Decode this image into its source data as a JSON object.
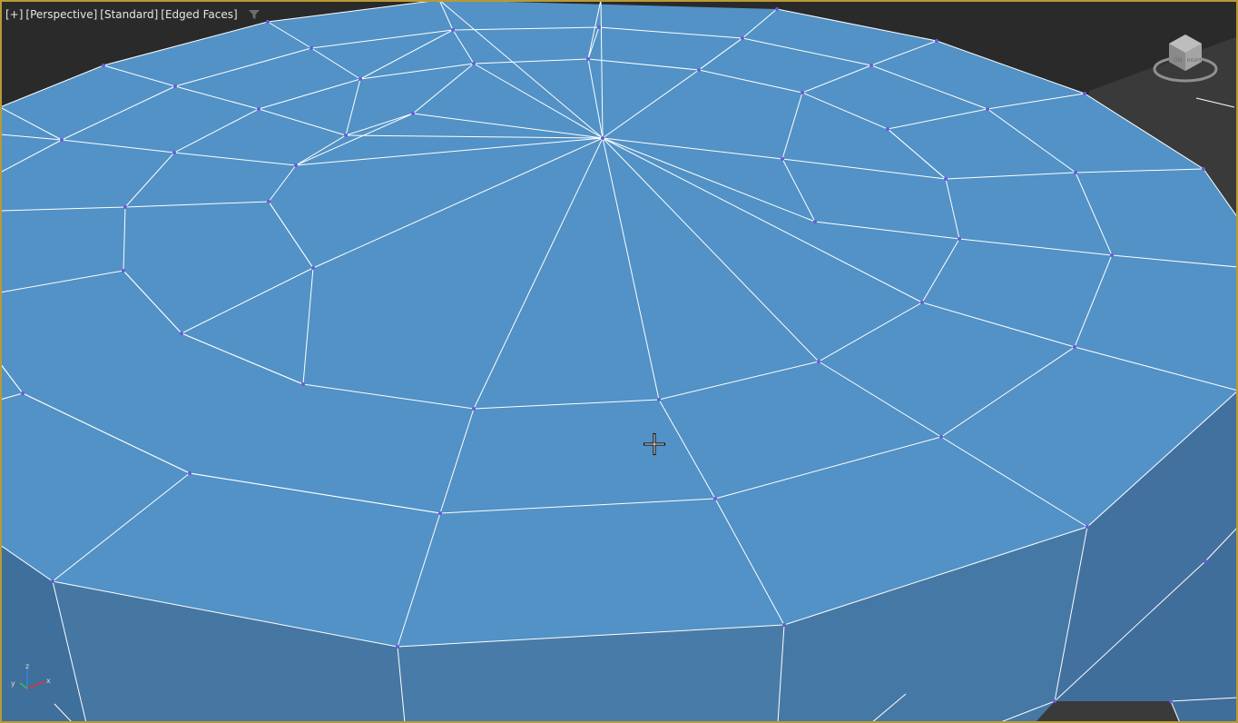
{
  "viewport": {
    "labels": [
      "[+]",
      "[Perspective]",
      "[Standard]",
      "[Edged Faces]"
    ],
    "filter_icon": "filter-icon",
    "border_color": "#b89a35",
    "background_color": "#2b2b2b",
    "mesh_color": "#5292c6",
    "mesh_side_color": "#4579a7",
    "edge_color": "#ffffff"
  },
  "viewcube": {
    "icon": "viewcube-icon",
    "face_text": [
      "ON",
      "RIGHT"
    ]
  },
  "axis_triad": {
    "x_label": "x",
    "y_label": "y",
    "z_label": "z"
  },
  "cursor": {
    "icon": "move-crosshair-icon"
  }
}
